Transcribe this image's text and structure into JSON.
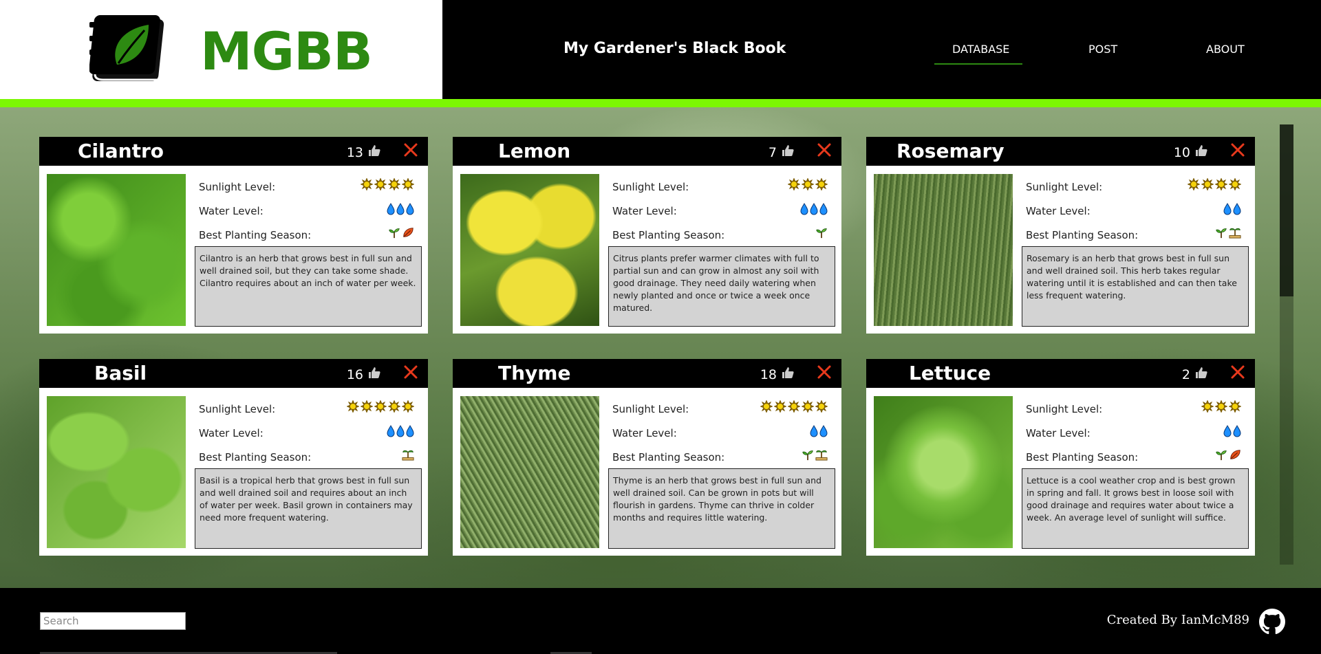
{
  "header": {
    "logo_text": "MGBB",
    "site_title": "My Gardener's Black Book",
    "nav": [
      {
        "label": "DATABASE",
        "active": true
      },
      {
        "label": "POST",
        "active": false
      },
      {
        "label": "ABOUT",
        "active": false
      }
    ]
  },
  "labels": {
    "sunlight": "Sunlight Level:",
    "water": "Water Level:",
    "season": "Best Planting Season:"
  },
  "plants": [
    {
      "name": "Cilantro",
      "likes": "13",
      "sunlight": 4,
      "water": 3,
      "seasons": [
        "spring",
        "fall"
      ],
      "description": "Cilantro is an herb that grows best in full sun and well drained soil, but they can take some shade. Cilantro requires about an inch of water per week."
    },
    {
      "name": "Lemon",
      "likes": "7",
      "sunlight": 3,
      "water": 3,
      "seasons": [
        "spring"
      ],
      "description": "Citrus plants prefer warmer climates with full to partial sun and can grow in almost any soil with good drainage. They need daily watering when newly planted and once or twice a week once matured."
    },
    {
      "name": "Rosemary",
      "likes": "10",
      "sunlight": 4,
      "water": 2,
      "seasons": [
        "spring",
        "summer"
      ],
      "description": "Rosemary is an herb that grows best in full sun and well drained soil. This herb takes regular watering until it is established and can then take less frequent watering."
    },
    {
      "name": "Basil",
      "likes": "16",
      "sunlight": 5,
      "water": 3,
      "seasons": [
        "summer"
      ],
      "description": "Basil is a tropical herb that grows best in full sun and well drained soil and requires about an inch of water per week. Basil grown in containers may need more frequent watering."
    },
    {
      "name": "Thyme",
      "likes": "18",
      "sunlight": 5,
      "water": 2,
      "seasons": [
        "spring",
        "summer"
      ],
      "description": "Thyme is an herb that grows best in full sun and well drained soil. Can be grown in pots but will flourish in gardens. Thyme can thrive in colder months and requires little watering."
    },
    {
      "name": "Lettuce",
      "likes": "2",
      "sunlight": 3,
      "water": 2,
      "seasons": [
        "spring",
        "fall"
      ],
      "description": "Lettuce is a cool weather crop and is best grown in spring and fall. It grows best in loose soil with good drainage and requires water about twice a week. An average level of sunlight will suffice."
    }
  ],
  "footer": {
    "search_placeholder": "Search",
    "created_by": "Created By IanMcM89"
  },
  "colors": {
    "brand_green": "#2d8a12",
    "accent_bar": "#7cf703",
    "close_red": "#e8391c",
    "sun": "#f5d20a",
    "water": "#1e90ff",
    "desc_bg": "#d3d3d3"
  }
}
